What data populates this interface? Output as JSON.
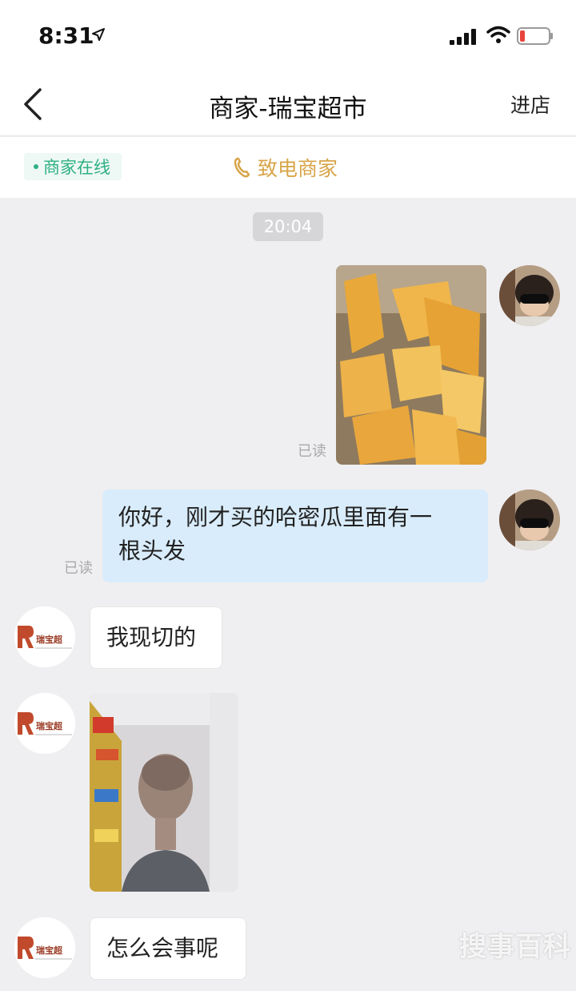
{
  "status_bar": {
    "time": "8:31"
  },
  "nav": {
    "title": "商家-瑞宝超市",
    "enter_store_label": "进店"
  },
  "sub_header": {
    "online_label": "商家在线",
    "call_label": "致电商家"
  },
  "chat": {
    "timestamp": "20:04",
    "read_label": "已读",
    "merchant_logo_text": "瑞宝超",
    "messages": [
      {
        "sender": "user",
        "type": "image",
        "content": "melon-photo",
        "read_label": "已读"
      },
      {
        "sender": "user",
        "type": "text",
        "line1": "你好，刚才买的哈密瓜里面有一",
        "line2": "根头发",
        "read_label": "已读"
      },
      {
        "sender": "merchant",
        "type": "text",
        "text": "我现切的"
      },
      {
        "sender": "merchant",
        "type": "image",
        "content": "staff-photo"
      },
      {
        "sender": "merchant",
        "type": "text",
        "text": "怎么会事呢"
      }
    ]
  },
  "watermark": "搜事百科",
  "colors": {
    "online_green": "#2fb083",
    "call_gold": "#d8a54a",
    "user_bubble": "#d9ecfb",
    "chat_bg": "#efeff1"
  }
}
